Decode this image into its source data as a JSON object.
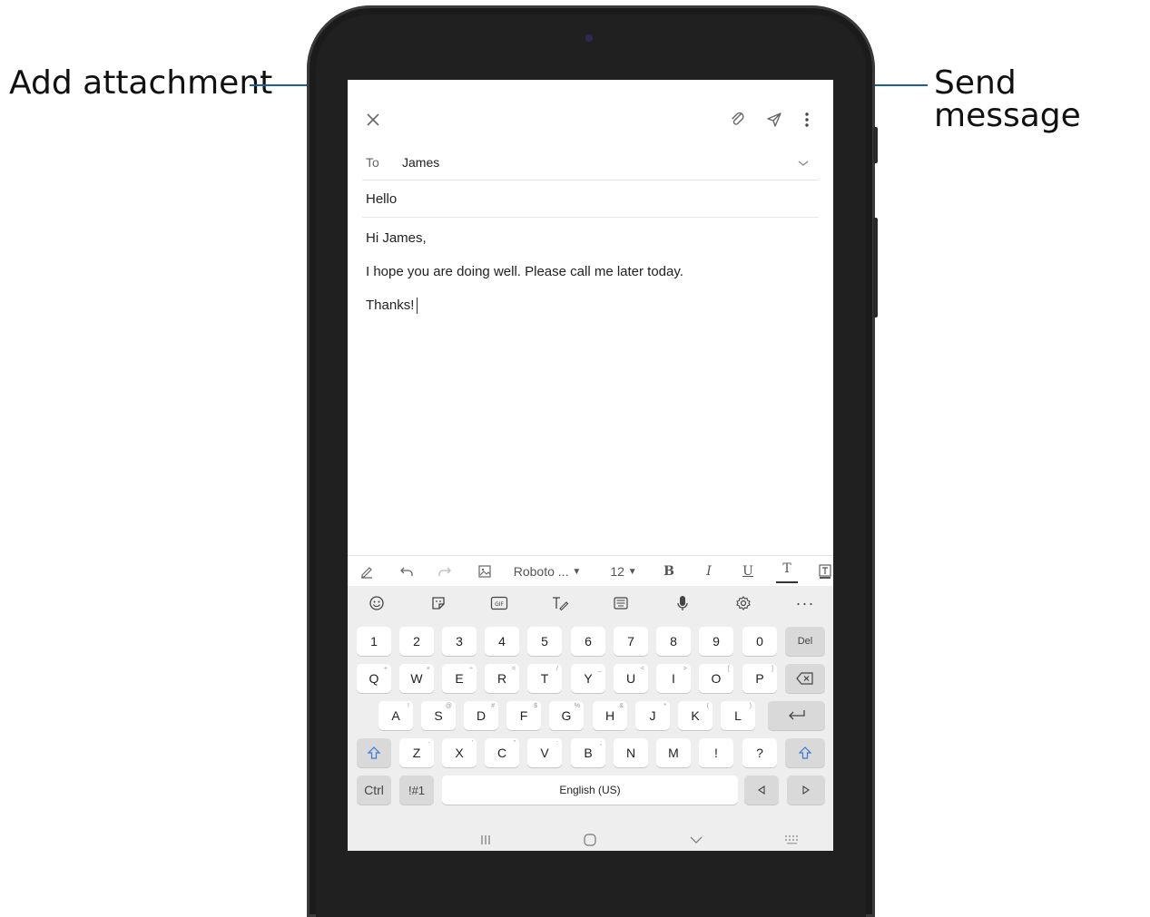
{
  "callouts": {
    "attachment": "Add attachment",
    "send": "Send message"
  },
  "icons": {
    "close": "close-icon",
    "attach": "paperclip-icon",
    "send": "send-icon",
    "more": "more-vertical-icon"
  },
  "compose": {
    "to_label": "To",
    "to_value": "James",
    "subject": "Hello",
    "body": {
      "line1": "Hi James,",
      "line2": "I hope you are doing well.  Please call me later today.",
      "line3": "Thanks!"
    }
  },
  "format_bar": {
    "font": "Roboto ...",
    "size": "12",
    "bold": "B",
    "italic": "I",
    "underline": "U",
    "text_color": "T"
  },
  "keyboard": {
    "numbers": [
      "1",
      "2",
      "3",
      "4",
      "5",
      "6",
      "7",
      "8",
      "9",
      "0"
    ],
    "del": "Del",
    "row1": [
      "Q",
      "W",
      "E",
      "R",
      "T",
      "Y",
      "U",
      "I",
      "O",
      "P"
    ],
    "row1_sup": [
      "+",
      "×",
      "÷",
      "=",
      "/",
      "_",
      "<",
      ">",
      "[",
      "]"
    ],
    "row2": [
      "A",
      "S",
      "D",
      "F",
      "G",
      "H",
      "J",
      "K",
      "L"
    ],
    "row2_sup": [
      "!",
      "@",
      "#",
      "$",
      "%",
      "&",
      "*",
      "(",
      ")"
    ],
    "row3": [
      "Z",
      "X",
      "C",
      "V",
      "B",
      "N",
      "M",
      "!",
      "?"
    ],
    "row3_sup": [
      "-",
      "'",
      "\"",
      ":",
      ";",
      "",
      "",
      "",
      ""
    ],
    "ctrl": "Ctrl",
    "symbols": "!#1",
    "space": "English (US)"
  },
  "colors": {
    "callout_line": "#1a5f9e",
    "accent_blue": "#3a7bd5"
  }
}
